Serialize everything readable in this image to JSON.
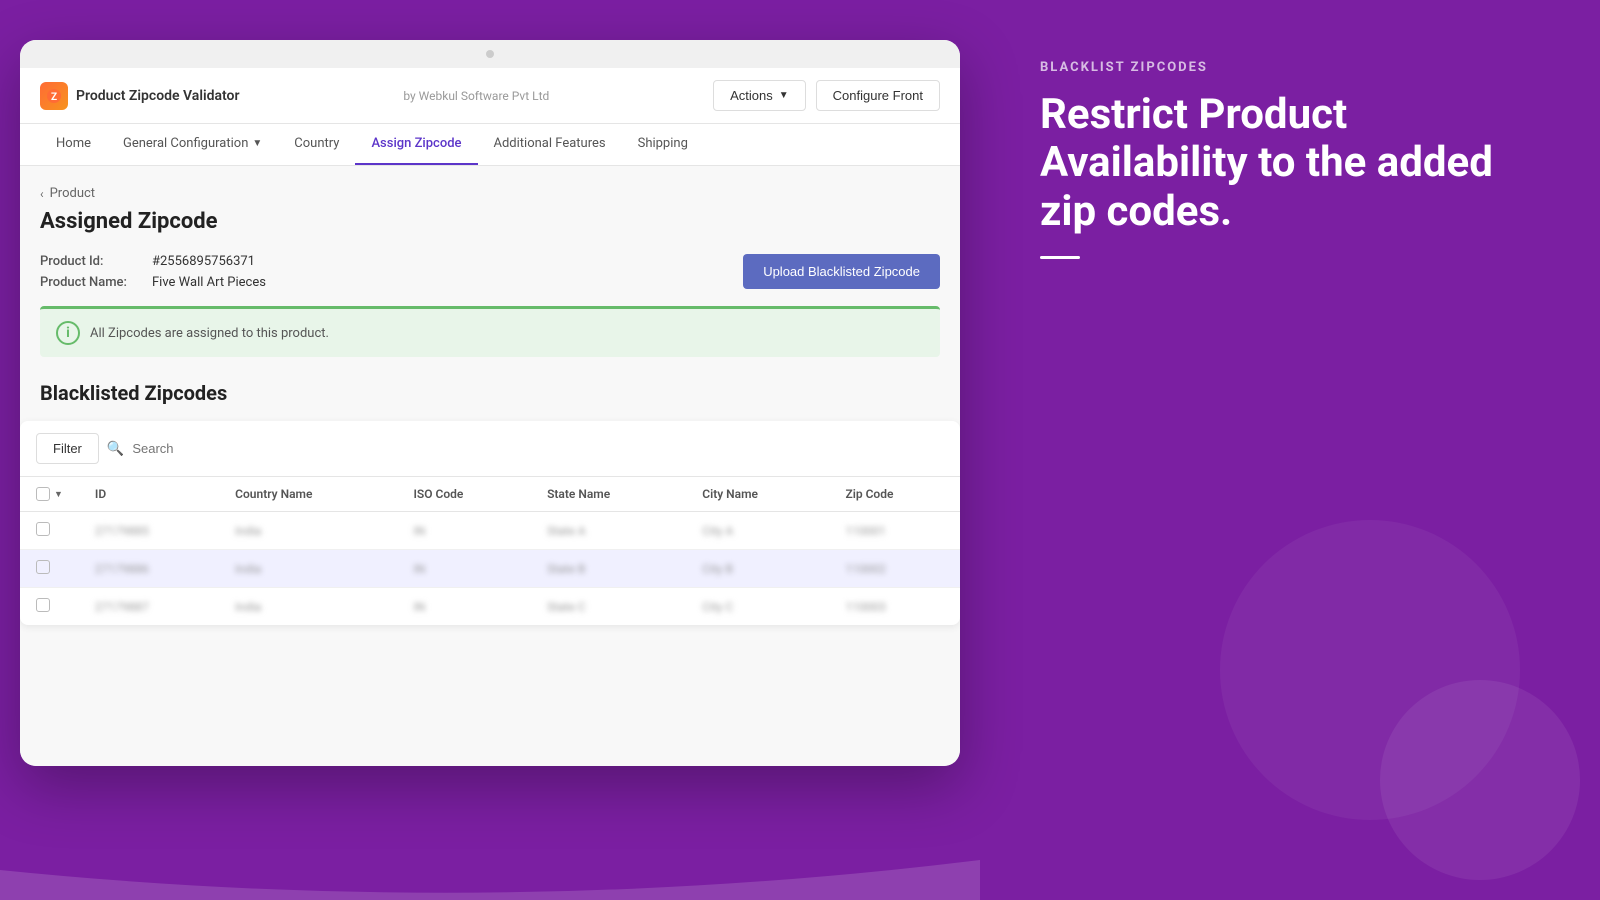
{
  "app": {
    "logo_text": "Z",
    "title": "Product Zipcode Validator",
    "vendor": "by Webkul Software Pvt Ltd"
  },
  "header": {
    "actions_label": "Actions",
    "configure_label": "Configure Front"
  },
  "nav": {
    "tabs": [
      {
        "id": "home",
        "label": "Home",
        "active": false
      },
      {
        "id": "general-configuration",
        "label": "General Configuration",
        "active": false,
        "has_dropdown": true
      },
      {
        "id": "country",
        "label": "Country",
        "active": false
      },
      {
        "id": "assign-zipcode",
        "label": "Assign Zipcode",
        "active": true
      },
      {
        "id": "additional-features",
        "label": "Additional Features",
        "active": false
      },
      {
        "id": "shipping",
        "label": "Shipping",
        "active": false
      }
    ]
  },
  "breadcrumb": {
    "back_label": "Product"
  },
  "page": {
    "title": "Assigned Zipcode",
    "product_id_label": "Product Id:",
    "product_id_value": "#2556895756371",
    "product_name_label": "Product Name:",
    "product_name_value": "Five Wall Art Pieces",
    "upload_button_label": "Upload Blacklisted Zipcode",
    "alert_text": "All Zipcodes are assigned to this product.",
    "section_title": "Blacklisted Zipcodes"
  },
  "table": {
    "filter_label": "Filter",
    "search_placeholder": "Search",
    "columns": [
      {
        "id": "checkbox",
        "label": ""
      },
      {
        "id": "id",
        "label": "ID"
      },
      {
        "id": "country_name",
        "label": "Country Name"
      },
      {
        "id": "iso_code",
        "label": "ISO Code"
      },
      {
        "id": "state_name",
        "label": "State Name"
      },
      {
        "id": "city_name",
        "label": "City Name"
      },
      {
        "id": "zip_code",
        "label": "Zip Code"
      }
    ],
    "rows": [
      {
        "id": "27179885",
        "country": "India",
        "iso": "IN",
        "state": "State A",
        "city": "City A",
        "zip": "110001"
      },
      {
        "id": "27179886",
        "country": "India",
        "iso": "IN",
        "state": "State B",
        "city": "City B",
        "zip": "110002",
        "highlighted": true
      },
      {
        "id": "27179887",
        "country": "India",
        "iso": "IN",
        "state": "State C",
        "city": "City C",
        "zip": "110003"
      }
    ]
  },
  "sidebar": {
    "label": "BLACKLIST ZIPCODES",
    "heading": "Restrict Product Availability to the added zip codes."
  },
  "colors": {
    "accent_purple": "#5c35c9",
    "background_purple": "#7b1fa2",
    "green_border": "#66bb6a",
    "upload_button": "#5c6bc0"
  }
}
